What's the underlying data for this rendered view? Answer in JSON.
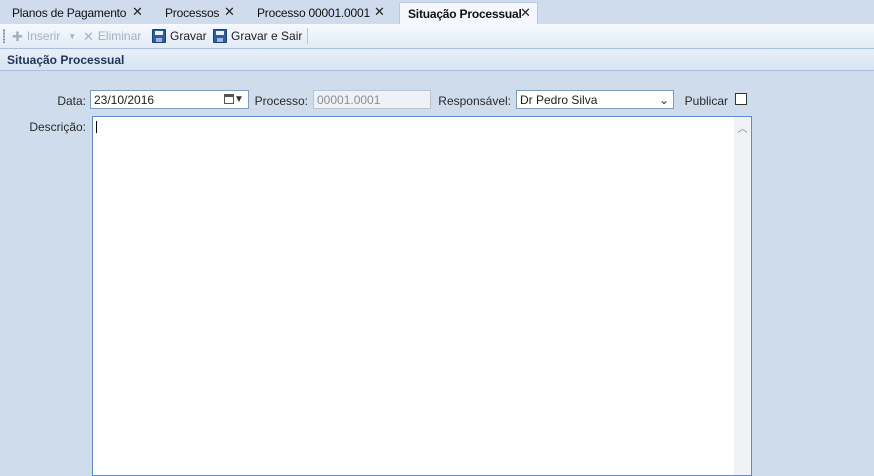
{
  "tabs": [
    {
      "label": "Planos de Pagamento",
      "close": "✕"
    },
    {
      "label": "Processos",
      "close": "✕"
    },
    {
      "label": "Processo 00001.0001",
      "close": "✕"
    },
    {
      "label": "Situação Processual",
      "close": "✕"
    }
  ],
  "toolbar": {
    "insert_label": "Inserir",
    "delete_label": "Eliminar",
    "save_label": "Gravar",
    "save_exit_label": "Gravar e Sair"
  },
  "panel": {
    "title": "Situação Processual"
  },
  "form": {
    "date_label": "Data:",
    "date_value": "23/10/2016",
    "process_label": "Processo:",
    "process_value": "00001.0001",
    "responsible_label": "Responsável:",
    "responsible_value": "Dr Pedro Silva",
    "publish_label": "Publicar",
    "publish_checked": false,
    "description_label": "Descrição:",
    "description_value": ""
  },
  "icons": {
    "insert": "plus-icon",
    "delete": "x-icon",
    "save": "floppy-disk-icon",
    "save_exit": "floppy-disk-exit-icon"
  }
}
